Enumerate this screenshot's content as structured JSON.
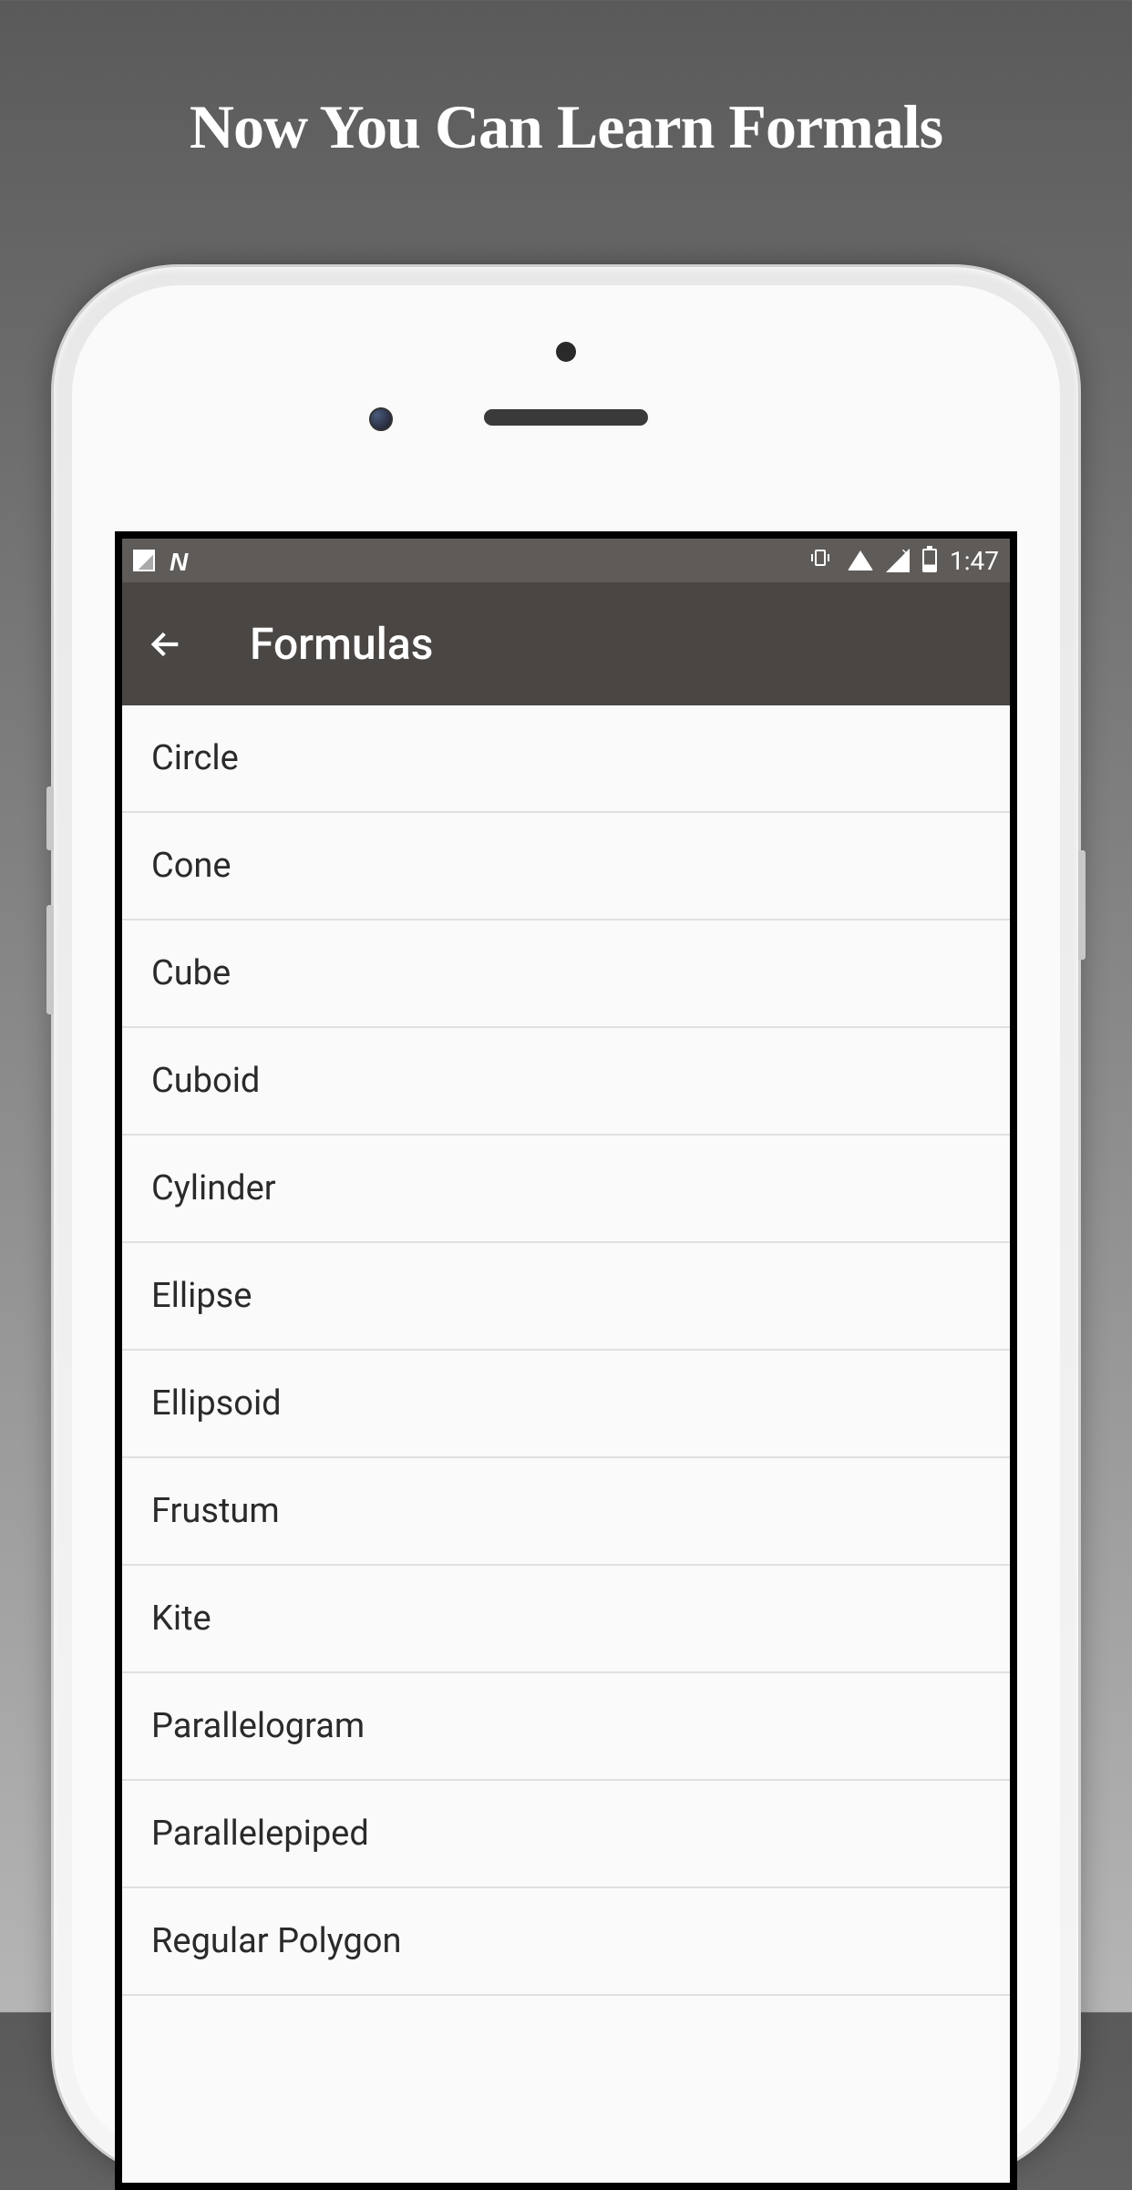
{
  "promo": {
    "title": "Now You Can Learn Formals"
  },
  "statusBar": {
    "time": "1:47"
  },
  "appBar": {
    "title": "Formulas"
  },
  "list": {
    "items": [
      "Circle",
      "Cone",
      "Cube",
      "Cuboid",
      "Cylinder",
      "Ellipse",
      "Ellipsoid",
      "Frustum",
      "Kite",
      "Parallelogram",
      "Parallelepiped",
      "Regular Polygon"
    ]
  }
}
